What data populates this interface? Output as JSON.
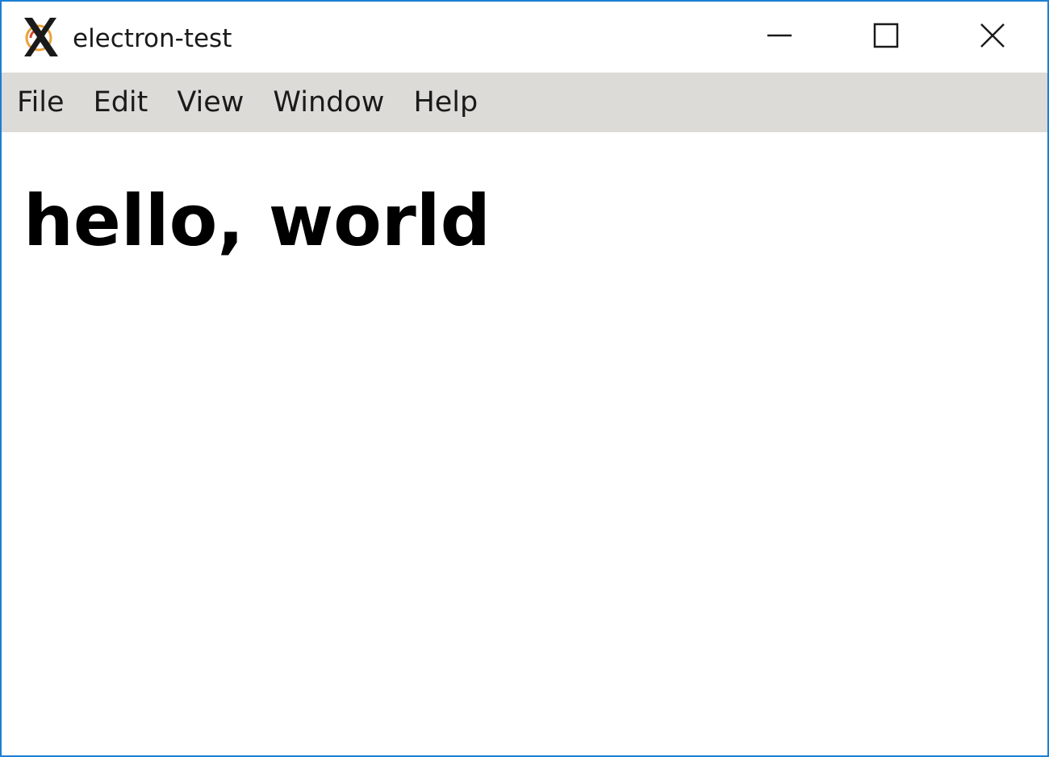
{
  "window": {
    "title": "electron-test",
    "border_color": "#1b7fd4",
    "icons": {
      "app": "x11-logo-icon",
      "minimize": "minimize-icon",
      "maximize": "maximize-icon",
      "close": "close-icon"
    }
  },
  "menubar": {
    "background": "#dcdbd7",
    "items": [
      {
        "label": "File"
      },
      {
        "label": "Edit"
      },
      {
        "label": "View"
      },
      {
        "label": "Window"
      },
      {
        "label": "Help"
      }
    ]
  },
  "content": {
    "heading": "hello, world"
  }
}
